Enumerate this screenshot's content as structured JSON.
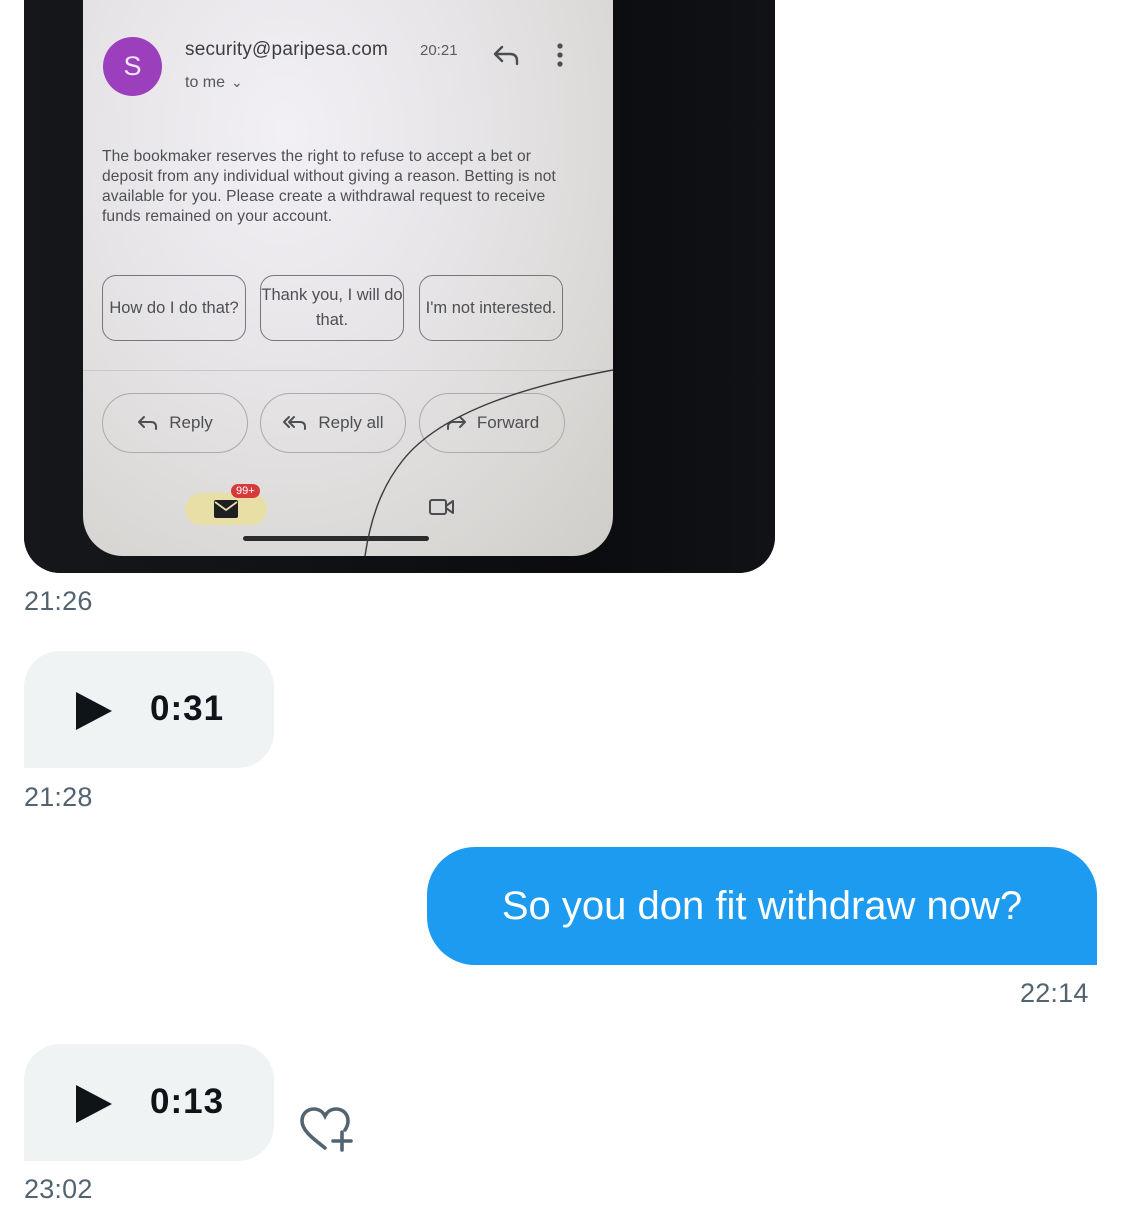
{
  "photo_message": {
    "email": {
      "avatar_letter": "S",
      "sender": "security@paripesa.com",
      "time": "20:21",
      "recipient": "to me",
      "body": "The bookmaker reserves the right to refuse to accept a bet or deposit from any individual without giving a reason. Betting is not available for you. Please create a withdrawal request to receive funds remained on your account.",
      "smart_replies": [
        "How do I do that?",
        "Thank you, I will do that.",
        "I'm not interested."
      ],
      "actions": [
        "Reply",
        "Reply all",
        "Forward"
      ],
      "mail_badge": "99+"
    },
    "timestamp": "21:26"
  },
  "voice_message_1": {
    "duration": "0:31",
    "timestamp": "21:28"
  },
  "sent_message": {
    "text": "So you don fit withdraw now?",
    "timestamp": "22:14"
  },
  "voice_message_2": {
    "duration": "0:13",
    "timestamp": "23:02"
  },
  "colors": {
    "sent_bubble": "#1d9bf0",
    "received_bubble": "#eff3f4",
    "timestamp": "#536471",
    "avatar": "#9b3fbd"
  }
}
